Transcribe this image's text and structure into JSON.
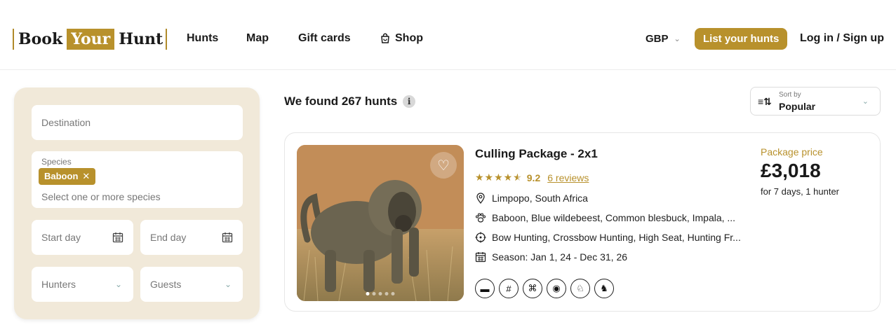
{
  "header": {
    "logo": {
      "word1": "Book",
      "word2": "Your",
      "word3": "Hunt"
    },
    "nav": [
      {
        "label": "Hunts"
      },
      {
        "label": "Map"
      },
      {
        "label": "Gift cards"
      },
      {
        "label": "Shop",
        "icon": "shopping-bag-icon"
      }
    ],
    "currency": "GBP",
    "list_button": "List your hunts",
    "login": "Log in / Sign up"
  },
  "filters": {
    "destination_placeholder": "Destination",
    "species_label": "Species",
    "species_tags": [
      "Baboon"
    ],
    "species_placeholder": "Select one or more species",
    "start_day": "Start day",
    "end_day": "End day",
    "hunters": "Hunters",
    "guests": "Guests"
  },
  "results": {
    "found_text": "We found 267 hunts",
    "info_glyph": "i",
    "sort_label": "Sort by",
    "sort_value": "Popular"
  },
  "card": {
    "title": "Culling Package - 2x1",
    "rating": 4.5,
    "score": "9.2",
    "reviews": "6 reviews",
    "location": "Limpopo, South Africa",
    "species": "Baboon, Blue wildebeest, Common blesbuck, Impala, ...",
    "methods": "Bow Hunting, Crossbow Hunting, High Seat, Hunting Fr...",
    "season": "Season: Jan 1, 24 - Dec 31, 26",
    "price_label": "Package price",
    "price": "£3,018",
    "price_note": "for 7 days, 1 hunter",
    "photo_count": 5,
    "photo_index": 1,
    "features": [
      "accommodation-icon",
      "fence-icon",
      "rifle-icon",
      "car-icon",
      "antelope-icon",
      "rabbit-icon"
    ]
  },
  "colors": {
    "accent": "#b8912c",
    "panel": "#f1e9d9"
  }
}
